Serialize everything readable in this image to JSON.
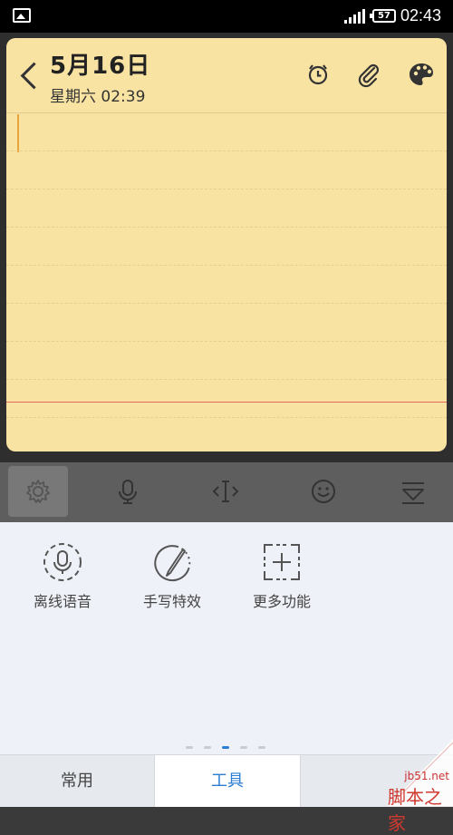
{
  "status_bar": {
    "battery": "57",
    "time": "02:43",
    "icons": [
      "image-icon",
      "signal-icon",
      "battery-icon"
    ]
  },
  "note": {
    "date": "5月16日",
    "subdate": "星期六 02:39",
    "header_icons": [
      "alarm-icon",
      "attachment-icon",
      "palette-icon"
    ],
    "paper_color": "#f9e3a3"
  },
  "toolbar": {
    "buttons": [
      "settings-icon",
      "microphone-icon",
      "cursor-move-icon",
      "emoji-icon",
      "collapse-keyboard-icon"
    ]
  },
  "tools_panel": {
    "items": [
      {
        "label": "离线语音",
        "icon": "offline-voice-icon"
      },
      {
        "label": "手写特效",
        "icon": "handwriting-effect-icon"
      },
      {
        "label": "更多功能",
        "icon": "more-functions-icon"
      }
    ],
    "page_count": 5,
    "active_page": 3
  },
  "tabs": [
    {
      "label": "常用"
    },
    {
      "label": "工具",
      "active": true
    }
  ],
  "watermark": {
    "url": "jb51.net",
    "text": "脚本之家"
  },
  "colors": {
    "accent": "#2d7dd2",
    "red_margin": "#e46a5a"
  }
}
